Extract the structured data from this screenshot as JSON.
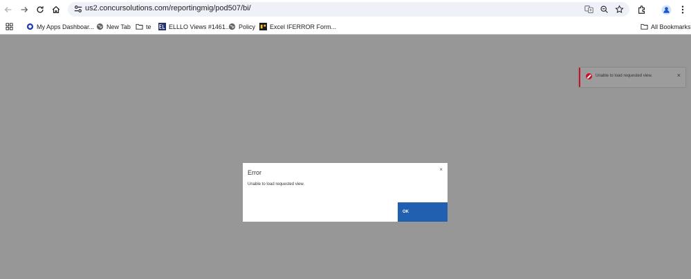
{
  "browser": {
    "url": "us2.concursolutions.com/reportingmig/pod507/bi/",
    "icons": [
      "back-icon",
      "forward-icon",
      "reload-icon",
      "home-icon",
      "site-info-icon",
      "translate-icon",
      "zoom-icon",
      "star-icon",
      "extensions-icon",
      "profile-icon",
      "menu-icon"
    ]
  },
  "bookmarks": {
    "items": [
      {
        "label": "My Apps Dashboar...",
        "icon": "apps-dashboard-icon"
      },
      {
        "label": "New Tab",
        "icon": "globe-icon"
      },
      {
        "label": "te",
        "icon": "folder-icon"
      },
      {
        "label": "ELLLO Views #1461...",
        "icon": "ellio-icon"
      },
      {
        "label": "Policy",
        "icon": "globe-icon"
      },
      {
        "label": "Excel IFERROR Form...",
        "icon": "excel-site-icon"
      }
    ],
    "all_bookmarks": "All Bookmarks"
  },
  "toast": {
    "message": "Unable to load requested view.",
    "close": "×",
    "accent_color": "#c8102e"
  },
  "dialog": {
    "title": "Error",
    "message": "Unable to load requested view.",
    "close": "×",
    "ok_label": "OK",
    "ok_color": "#215fb0"
  }
}
